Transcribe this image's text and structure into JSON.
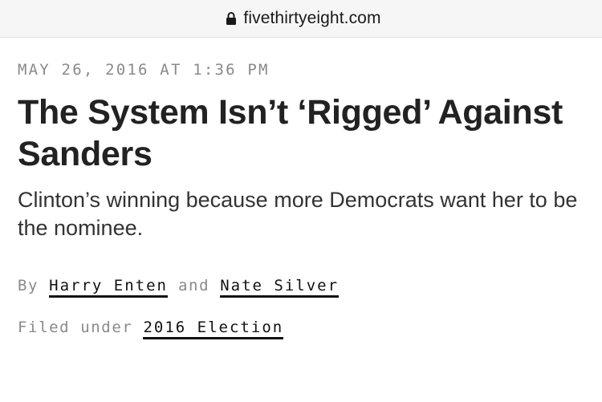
{
  "browser": {
    "url": "fivethirtyeight.com",
    "lock_icon": "lock-icon"
  },
  "article": {
    "dateline": "MAY 26, 2016 AT 1:36 PM",
    "headline": "The System Isn’t ‘Rigged’ Against Sanders",
    "dek": "Clinton’s winning because more Democrats want her to be the nominee.",
    "byline": {
      "prefix": "By",
      "authors": [
        "Harry Enten",
        "Nate Silver"
      ],
      "separator": "and"
    },
    "filed": {
      "prefix": "Filed under",
      "category": "2016 Election"
    }
  },
  "colors": {
    "meta_gray": "#8a8a8a",
    "headline": "#222222",
    "link_underline": "#111111",
    "urlbar_bg": "#f6f6f6"
  }
}
